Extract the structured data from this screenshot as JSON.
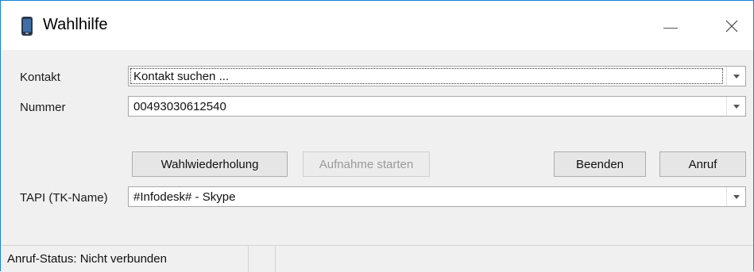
{
  "window": {
    "title": "Wahlhilfe",
    "title_icon": "mobile-phone-icon",
    "minimize_icon": "minimize-icon",
    "close_icon": "close-icon",
    "border_color": "#1883d7"
  },
  "form": {
    "contact_label": "Kontakt",
    "contact_value": "Kontakt suchen ...",
    "number_label": "Nummer",
    "number_value": "00493030612540",
    "tapi_label": "TAPI (TK-Name)",
    "tapi_value": "#Infodesk# - Skype"
  },
  "buttons": {
    "redial": "Wahlwiederholung",
    "record": "Aufnahme starten",
    "end": "Beenden",
    "call": "Anruf"
  },
  "status": {
    "text": "Anruf-Status: Nicht verbunden"
  }
}
